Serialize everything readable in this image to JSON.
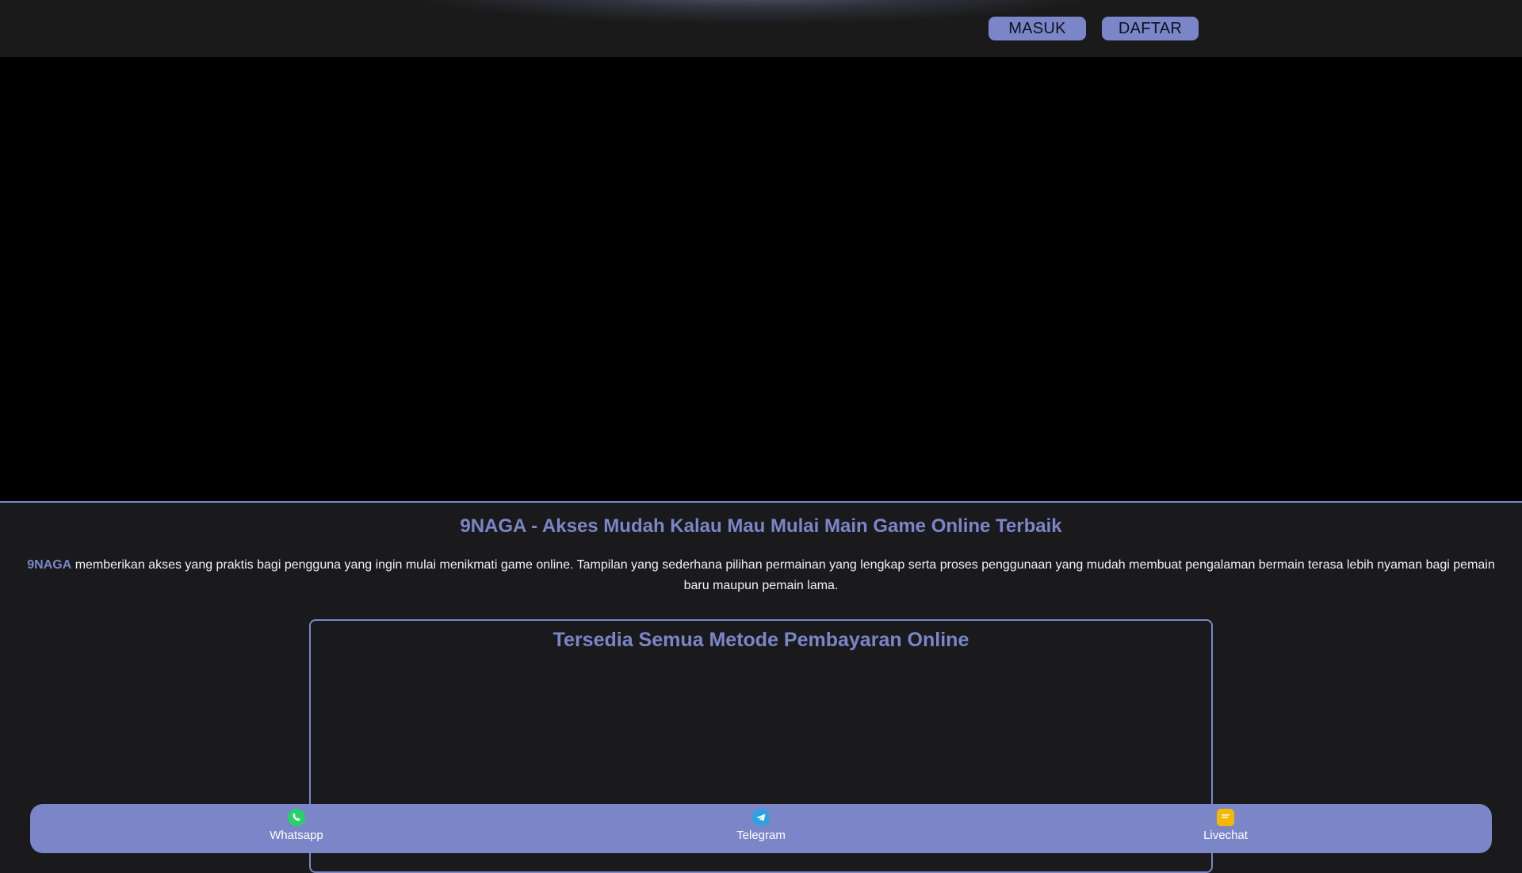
{
  "header": {
    "login_label": "MASUK",
    "register_label": "DAFTAR"
  },
  "content": {
    "title": "9NAGA - Akses Mudah Kalau Mau Mulai Main Game Online Terbaik",
    "intro_brand": "9NAGA",
    "intro_text": " memberikan akses yang praktis bagi pengguna yang ingin mulai menikmati game online. Tampilan yang sederhana pilihan permainan yang lengkap serta proses penggunaan yang mudah membuat pengalaman bermain terasa lebih nyaman bagi pemain baru maupun pemain lama."
  },
  "payment": {
    "title": "Tersedia Semua Metode Pembayaran Online"
  },
  "bottom_bar": {
    "items": [
      {
        "label": "Whatsapp",
        "icon": "whatsapp-icon",
        "color": "#25d366"
      },
      {
        "label": "Telegram",
        "icon": "telegram-icon",
        "color": "#2aa3e0"
      },
      {
        "label": "Livechat",
        "icon": "livechat-icon",
        "color": "#f5b800"
      }
    ]
  },
  "colors": {
    "accent": "#7b86c8",
    "background": "#1a1a1c",
    "hero": "#000000"
  }
}
